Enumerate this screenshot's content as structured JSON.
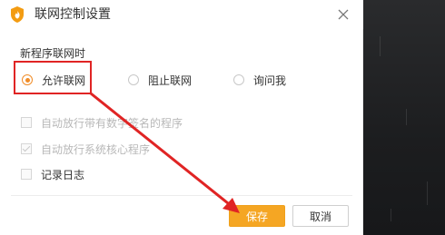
{
  "dialog": {
    "title": "联网控制设置",
    "close_icon": "close-icon",
    "app_icon": "shield-flame-icon"
  },
  "network_policy": {
    "section_title": "新程序联网时",
    "options": [
      {
        "label": "允许联网",
        "selected": true
      },
      {
        "label": "阻止联网",
        "selected": false
      },
      {
        "label": "询问我",
        "selected": false
      }
    ]
  },
  "settings": [
    {
      "label": "自动放行带有数字签名的程序",
      "checked": false,
      "enabled": false
    },
    {
      "label": "自动放行系统核心程序",
      "checked": true,
      "enabled": false
    },
    {
      "label": "记录日志",
      "checked": false,
      "enabled": true
    }
  ],
  "buttons": {
    "save": "保存",
    "cancel": "取消"
  },
  "colors": {
    "accent": "#f5a623",
    "annotation": "#e02424"
  }
}
